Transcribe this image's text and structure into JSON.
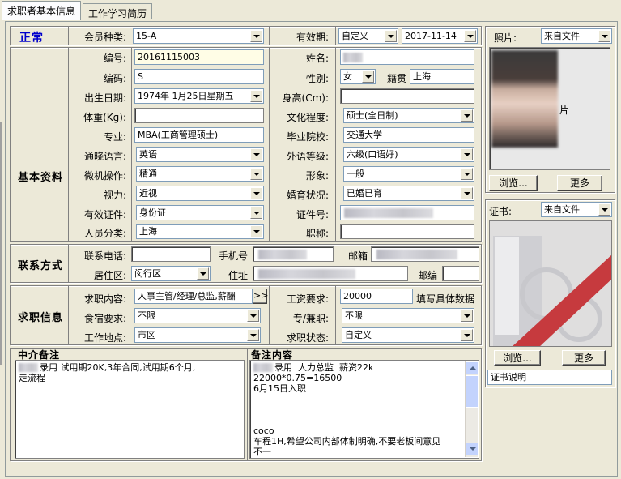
{
  "tabs": [
    {
      "label": "求职者基本信息"
    },
    {
      "label": "工作学习简历"
    }
  ],
  "status": "正常",
  "sections": {
    "basic": "基本资料",
    "contact": "联系方式",
    "job": "求职信息"
  },
  "labels": {
    "member_type": "会员种类:",
    "validity": "有效期:",
    "number": "编号:",
    "name": "姓名:",
    "code": "编码:",
    "gender": "性别:",
    "native": "籍贯",
    "birth": "出生日期:",
    "height": "身高(Cm):",
    "weight": "体重(Kg):",
    "education": "文化程度:",
    "major": "专业:",
    "school": "毕业院校:",
    "language": "通晓语言:",
    "foreign_level": "外语等级:",
    "computer": "微机操作:",
    "image": "形象:",
    "vision": "视力:",
    "marital": "婚育状况:",
    "id_type": "有效证件:",
    "id_no": "证件号:",
    "category": "人员分类:",
    "title": "职称:",
    "phone": "联系电话:",
    "mobile": "手机号",
    "email": "邮箱",
    "residence": "居住区:",
    "address": "住址",
    "zip": "邮编",
    "job_content": "求职内容:",
    "salary": "工资要求:",
    "board": "食宿要求:",
    "fulltime": "专/兼职:",
    "location": "工作地点:",
    "job_status": "求职状态:",
    "photo": "照片:",
    "certificate": "证书:"
  },
  "values": {
    "member_type": "15-A",
    "validity_mode": "自定义",
    "validity_date": "2017-11-14",
    "number": "20161115003",
    "code": "S",
    "gender": "女",
    "native": "上海",
    "birth": "1974年 1月25日星期五",
    "education": "硕士(全日制)",
    "major": "MBA(工商管理硕士)",
    "school": "交通大学",
    "language": "英语",
    "foreign_level": "六级(口语好)",
    "computer": "精通",
    "image": "一般",
    "vision": "近视",
    "marital": "已婚已育",
    "id_type": "身份证",
    "category": "上海",
    "residence": "闵行区",
    "job_content": "人事主管/经理/总监,薪酬",
    "salary": "20000",
    "salary_hint": "填写具体数据",
    "board": "不限",
    "fulltime": "不限",
    "location": "市区",
    "job_status": "自定义",
    "photo_source": "来自文件",
    "cert_source": "来自文件",
    "photo_caption": "片",
    "cert_note": "证书说明"
  },
  "buttons": {
    "more_arrow": ">>",
    "browse1": "浏览...",
    "more1": "更多",
    "browse2": "浏览...",
    "more2": "更多"
  },
  "memos": {
    "agent_title": "中介备注",
    "agent_text": "录用 试用期20K,3年合同,试用期6个月,\n走流程",
    "note_title": "备注内容",
    "note_text": "录用  人力总监  薪资22k\n22000*0.75=16500\n6月15日入职\n\n\n\ncoco\n车程1H,希望公司内部体制明确,不要老板间意见\n不一"
  },
  "colors": {
    "status": "#0000cc",
    "window_bg": "#ece9d8",
    "field_border": "#7f9db9"
  }
}
